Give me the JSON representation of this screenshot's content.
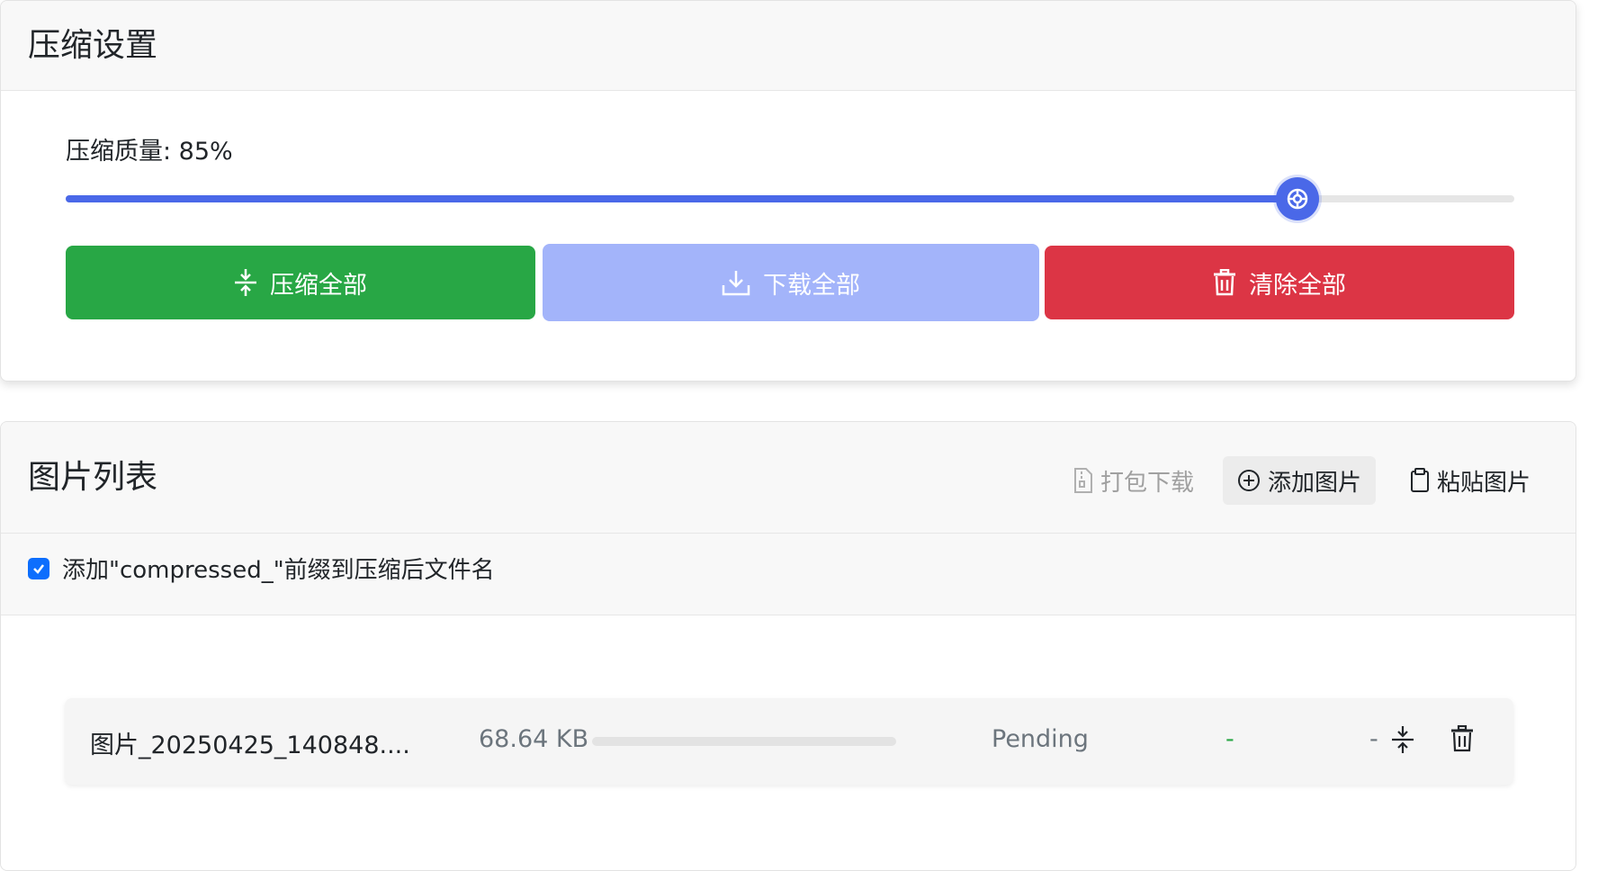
{
  "settings": {
    "title": "压缩设置",
    "quality_label": "压缩质量: 85%",
    "quality": 85,
    "buttons": {
      "compress_all": "压缩全部",
      "download_all": "下载全部",
      "clear_all": "清除全部"
    }
  },
  "image_list": {
    "title": "图片列表",
    "actions": {
      "pack_download": "打包下载",
      "add_images": "添加图片",
      "paste_images": "粘贴图片"
    },
    "prefix_option": {
      "checked": true,
      "label": "添加\"compressed_\"前缀到压缩后文件名"
    },
    "files": [
      {
        "name": "图片_20250425_140848....",
        "size": "68.64 KB",
        "progress": 0,
        "status": "Pending",
        "result": "-",
        "saved": "-"
      }
    ]
  },
  "colors": {
    "accent": "#4a68e8",
    "success": "#28a745",
    "danger": "#dc3545",
    "disabled_primary": "#a3b4fa"
  },
  "icons": {
    "compress": "compress-icon",
    "download": "download-icon",
    "trash": "trash-icon",
    "file_zip": "file-zip-icon",
    "plus_circle": "plus-circle-icon",
    "clipboard": "clipboard-icon",
    "check": "check-icon"
  }
}
